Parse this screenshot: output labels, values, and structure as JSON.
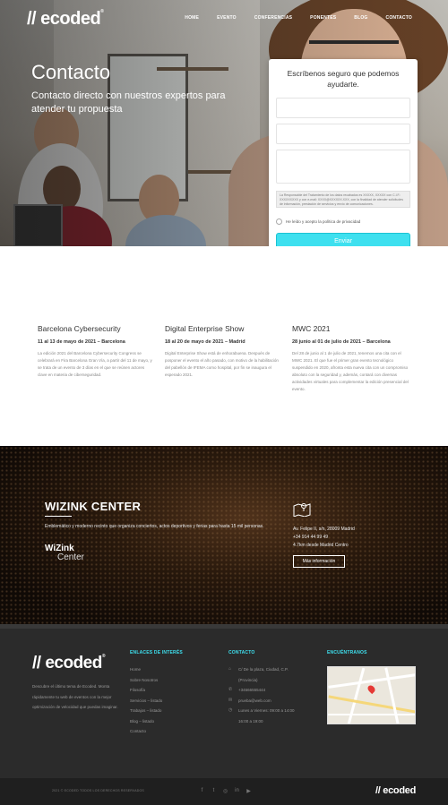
{
  "brand": {
    "logo": "// ecoded",
    "reg": "®"
  },
  "nav": {
    "items": [
      "Home",
      "Evento",
      "Conferencias",
      "Ponentes",
      "Blog",
      "Contacto"
    ]
  },
  "hero": {
    "title": "Contacto",
    "subtitle": "Contacto directo con nuestros expertos para atender tu propuesta"
  },
  "form": {
    "title": "Escríbenos seguro que podemos ayudarte.",
    "legal": "La Responsable del Tratamiento de los datos recabados es XXXXX, XXXXX con C.I.F.: XXXXXXXXX y con e-mail: XXXX@XXXXXX.XXX, con la finalidad de atender solicitudes de información, prestación de servicios y envío de comunicaciones.",
    "consent": "He leído y acepto la política de privacidad",
    "submit": "Enviar"
  },
  "events": [
    {
      "title": "Barcelona Cybersecurity",
      "date": "11 al 13 de mayo de 2021 – Barcelona",
      "text": "La edición 2021 del Barcelona Cybersecurity Congress se celebrará en Fira Barcelona Gran Vía, a partir del 11 de mayo, y se trata de un evento de 3 días en el que se reúnen actores clave en materia de ciberseguridad."
    },
    {
      "title": "Digital Enterprise Show",
      "date": "18 al 20 de mayo de 2021 – Madrid",
      "text": "Digital Enterprise Show está de enhorabuena. Después de posponer el evento el año pasado, con motivo de la habilitación del pabellón de IFEMA como hospital, por fin se inaugura el esperado 2021."
    },
    {
      "title": "MWC 2021",
      "date": "28 junio al 01 de julio de 2021 – Barcelona",
      "text": "Del 28 de junio al 1 de julio de 2021, tenemos una cita con el MWC 2021. El que fue el primer gran evento tecnológico suspendido en 2020, afronta esta nueva cita con un compromiso absoluto con la seguridad y, además, contará con diversas actividades virtuales para complementar la edición presencial del evento."
    }
  ],
  "venue": {
    "title": "WIZINK CENTER",
    "description": "Emblemático y moderno recinto que organiza conciertos, actos deportivos y ferias para hasta 15 mil personas.",
    "logo_top": "WiZink",
    "logo_bottom": "Center",
    "address1": "Av. Felipe II, s/n, 28009 Madrid",
    "phone": "+34 914 44 99 49",
    "distance": "4.7km desde Madrid Centro",
    "button": "Más información"
  },
  "footer": {
    "about": "Descubre el último tema de Ecoded. Monta rápidamente tu web de eventos con la mejor optimización de velocidad que puedas imaginar.",
    "links_title": "ENLACES DE INTERÉS",
    "links": [
      "Home",
      "Sobre Nosotros",
      "Filosofía",
      "Servicios – listado",
      "Trabajos – listado",
      "Blog – listado",
      "Contacto"
    ],
    "contact_title": "CONTACTO",
    "contact": {
      "address": "C/ De la plaza, Ciudad, C.P. (Provincia)",
      "phone": "+34666555444",
      "email": "prueba@web.com",
      "hours": "Lunes a Viernes: 09:00 a 14:00",
      "hours2": "16:00 a 19:00"
    },
    "map_title": "ENCUÉNTRANOS",
    "copyright": "2021 © ECODED TODOS LOS DERECHOS RESERVADOS",
    "bottom_logo": "// ecoded"
  },
  "icons": {
    "social": [
      "facebook-icon",
      "twitter-icon",
      "instagram-icon",
      "linkedin-icon",
      "youtube-icon"
    ],
    "contact": [
      "home-icon",
      "phone-icon",
      "mail-icon",
      "clock-icon"
    ]
  },
  "colors": {
    "accent": "#3ee0ef",
    "footer_bg": "#2b2b2b",
    "bottom_bg": "#1f1f1f"
  }
}
